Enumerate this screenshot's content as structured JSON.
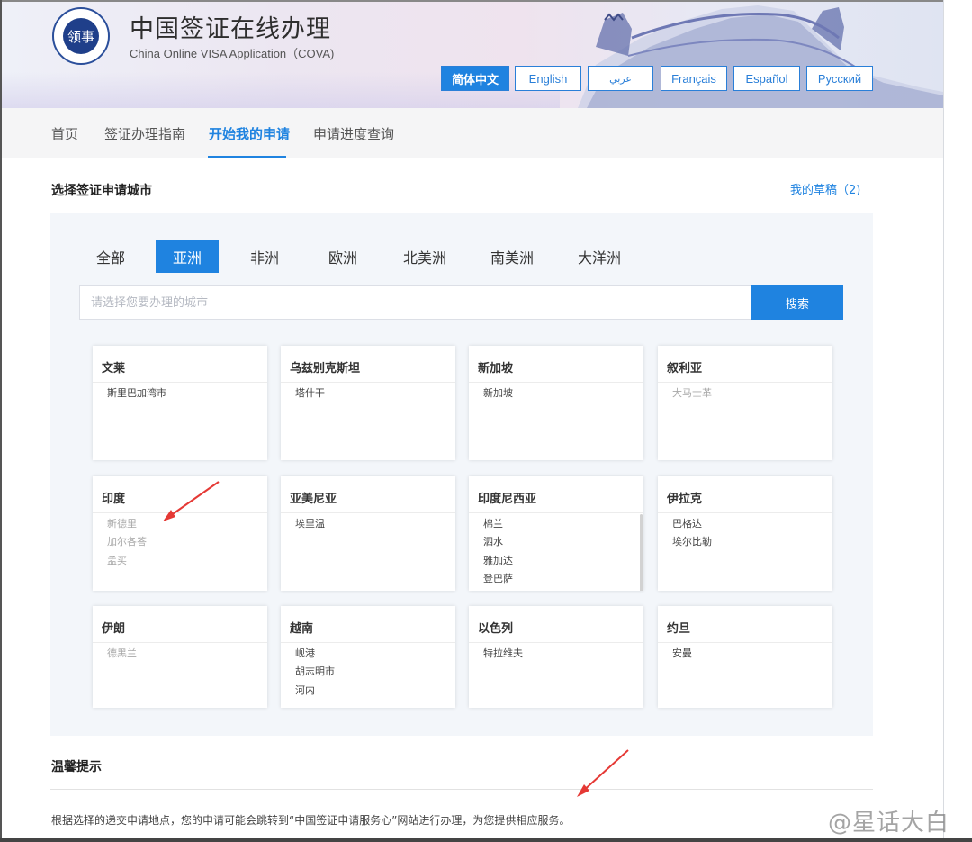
{
  "header": {
    "logo_text": "领事",
    "title": "中国签证在线办理",
    "subtitle": "China Online VISA Application（COVA)",
    "languages": [
      "简体中文",
      "English",
      "عربي",
      "Français",
      "Español",
      "Русский"
    ],
    "active_language": "简体中文"
  },
  "nav": {
    "items": [
      "首页",
      "签证办理指南",
      "开始我的申请",
      "申请进度查询"
    ],
    "active": "开始我的申请"
  },
  "main": {
    "section_title": "选择签证申请城市",
    "drafts_link": "我的草稿（2)",
    "region_tabs": [
      "全部",
      "亚洲",
      "非洲",
      "欧洲",
      "北美洲",
      "南美洲",
      "大洋洲"
    ],
    "active_region": "亚洲",
    "search": {
      "placeholder": "请选择您要办理的城市",
      "value": "",
      "button": "搜索"
    },
    "countries": [
      {
        "name": "文莱",
        "cities": [
          "斯里巴加湾市"
        ],
        "disabled": false
      },
      {
        "name": "乌兹别克斯坦",
        "cities": [
          "塔什干"
        ],
        "disabled": false
      },
      {
        "name": "新加坡",
        "cities": [
          "新加坡"
        ],
        "disabled": false
      },
      {
        "name": "叙利亚",
        "cities": [
          "大马士革"
        ],
        "disabled": true
      },
      {
        "name": "印度",
        "cities": [
          "新德里",
          "加尔各答",
          "孟买"
        ],
        "disabled": true
      },
      {
        "name": "亚美尼亚",
        "cities": [
          "埃里温"
        ],
        "disabled": false
      },
      {
        "name": "印度尼西亚",
        "cities": [
          "棉兰",
          "泗水",
          "雅加达",
          "登巴萨"
        ],
        "disabled": false,
        "scrollable": true
      },
      {
        "name": "伊拉克",
        "cities": [
          "巴格达",
          "埃尔比勒"
        ],
        "disabled": false
      },
      {
        "name": "伊朗",
        "cities": [
          "德黑兰"
        ],
        "disabled": true
      },
      {
        "name": "越南",
        "cities": [
          "岘港",
          "胡志明市",
          "河内"
        ],
        "disabled": false
      },
      {
        "name": "以色列",
        "cities": [
          "特拉维夫"
        ],
        "disabled": false
      },
      {
        "name": "约旦",
        "cities": [
          "安曼"
        ],
        "disabled": false
      }
    ]
  },
  "tips": {
    "title": "温馨提示",
    "text": "根据选择的递交申请地点，您的申请可能会跳转到“中国签证申请服务心”网站进行办理，为您提供相应服务。"
  },
  "watermark": "@星话大白",
  "colors": {
    "accent": "#1f83e0",
    "annotation_arrow": "#e53935",
    "disabled_text": "#a8a8a8"
  }
}
